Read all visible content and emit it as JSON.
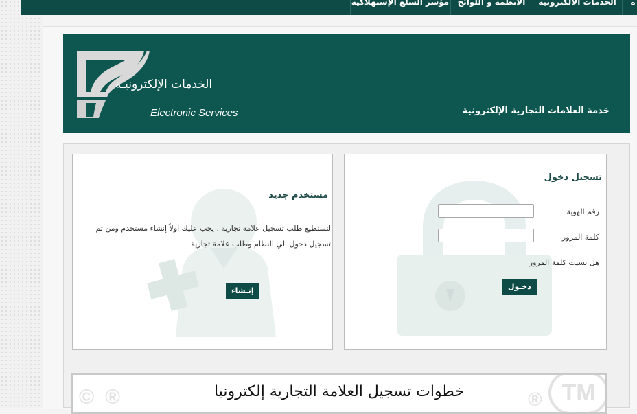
{
  "nav": {
    "items": [
      "ة",
      "الخدمات الالكترونية",
      "الانظمة و اللوائح",
      "مؤشر السلع الإستهلاكية"
    ]
  },
  "banner": {
    "logo_ar": "الخدمات الإلكترونيـة",
    "logo_en": "Electronic Services",
    "service_title": "خدمة العلامات التجارية الإلكترونية"
  },
  "login": {
    "title": "تسجيل دخول",
    "id_label": "رقم الهوية",
    "id_value": "",
    "password_label": "كلمة المرور",
    "password_value": "",
    "forgot_label": "هل نسيت كلمة المرور",
    "submit_label": "دخـول"
  },
  "register": {
    "title": "مستخدم جديد",
    "line1": "لتستطيع طلب تسجيل علامة تجارية ، يجب عليك اولاً إنشاء مستخدم ومن ثم",
    "line2": "تسجيل   دخول الي النظام وطلب علامة تجارية",
    "submit_label": "إنـشاء"
  },
  "steps": {
    "title": "خطوات تسجيل العلامة التجارية إلكترونيا",
    "tm_mark": "TM",
    "copyright_mark": "©",
    "registered_mark": "®"
  },
  "colors": {
    "nav_bg": "#0e4b46",
    "banner_bg": "#0e5750",
    "button_bg": "#0e4b46",
    "title_text": "#1d4a47"
  }
}
